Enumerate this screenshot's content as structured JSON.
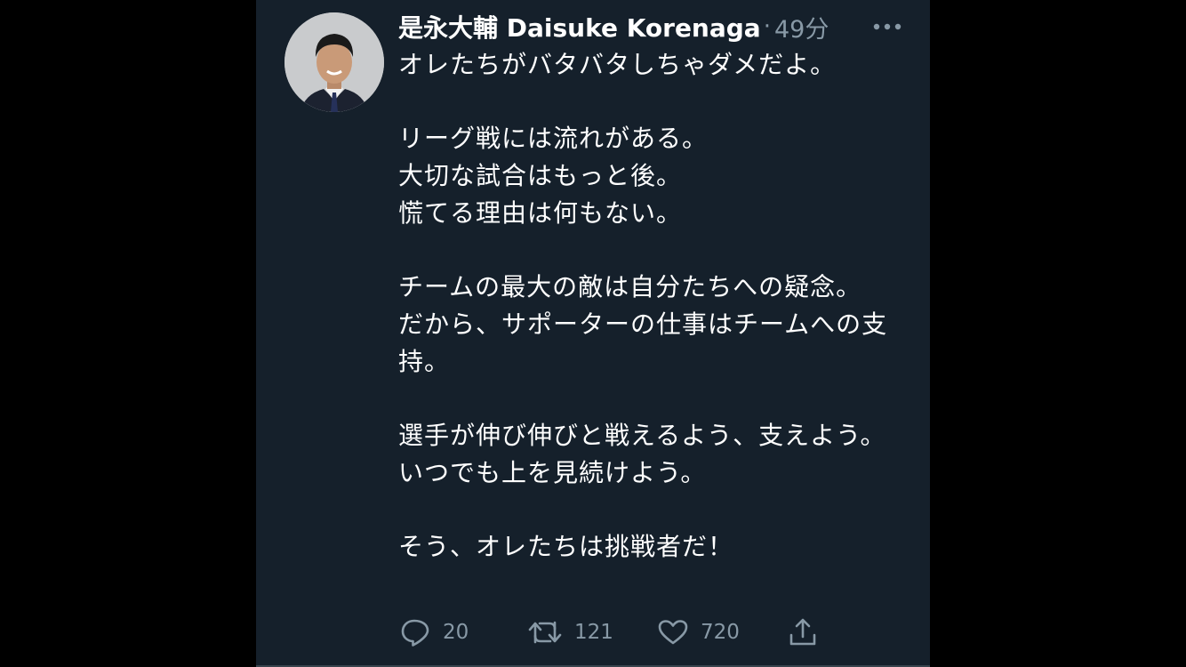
{
  "tweet": {
    "author": {
      "display_name": "是永大輔 Daisuke Korenaga"
    },
    "separator": "·",
    "time": "49分",
    "paragraphs": [
      "オレたちがバタバタしちゃダメだよ。",
      "リーグ戦には流れがある。\n大切な試合はもっと後。\n慌てる理由は何もない。",
      "チームの最大の敵は自分たちへの疑念。\nだから、サポーターの仕事はチームへの支持。",
      "選手が伸び伸びと戦えるよう、支えよう。\nいつでも上を見続けよう。",
      "そう、オレたちは挑戦者だ！"
    ],
    "actions": {
      "reply": {
        "icon": "reply-icon",
        "count": "20"
      },
      "retweet": {
        "icon": "retweet-icon",
        "count": "121"
      },
      "like": {
        "icon": "heart-icon",
        "count": "720"
      },
      "share": {
        "icon": "share-icon"
      }
    },
    "colors": {
      "background": "#15202b",
      "outer": "#000000",
      "text": "#ffffff",
      "secondary": "#8899a6"
    }
  }
}
